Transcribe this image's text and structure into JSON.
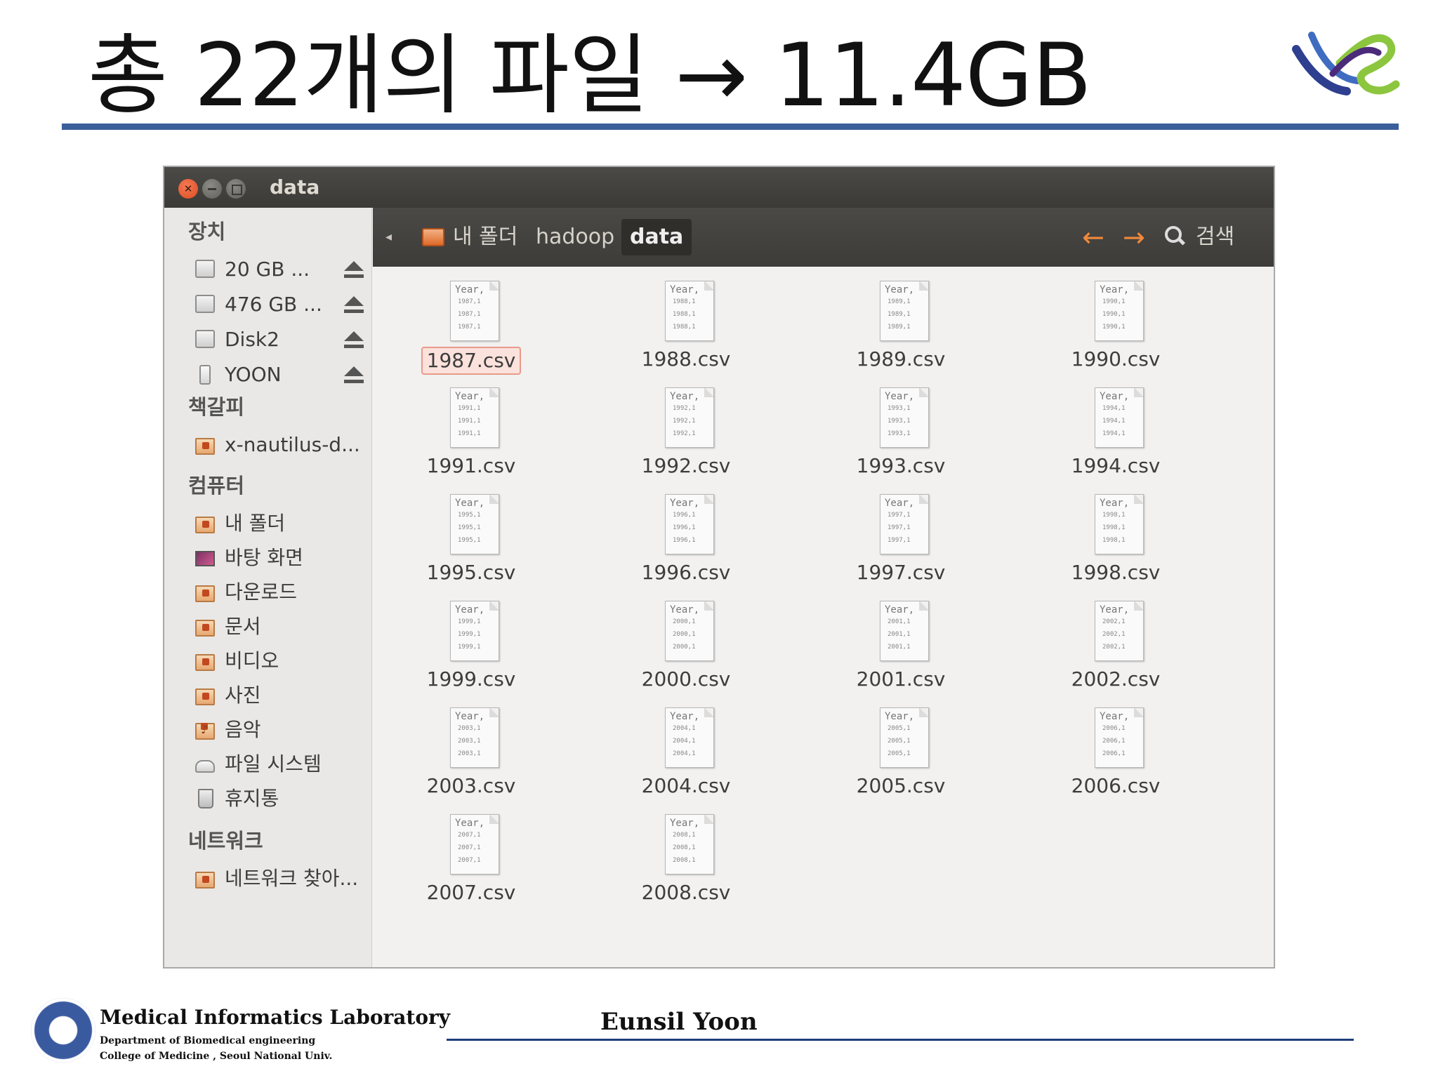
{
  "slide": {
    "title": "총 22개의 파일 → 11.4GB",
    "footer": {
      "lab": "Medical  Informatics Laboratory",
      "department": "Department of Biomedical engineering",
      "college": "College of Medicine , Seoul  National  Univ.",
      "author": "Eunsil Yoon"
    },
    "colors": {
      "title_rule": "#3a5f9a",
      "footer_rule": "#1f3e7a"
    }
  },
  "window": {
    "title": "data",
    "controls": [
      "close-icon",
      "minimize-icon",
      "maximize-icon"
    ],
    "toolbar": {
      "breadcrumbs": [
        "내 폴더",
        "hadoop",
        "data"
      ],
      "active_crumb": "data",
      "back_icon": "←",
      "forward_icon": "→",
      "search_label": "검색"
    },
    "sidebar": {
      "devices_heading": "장치",
      "devices": [
        {
          "label": "20 GB ...",
          "icon": "drive-icon",
          "eject": true
        },
        {
          "label": "476 GB ...",
          "icon": "drive-icon",
          "eject": true
        },
        {
          "label": "Disk2",
          "icon": "drive-icon",
          "eject": true
        },
        {
          "label": "YOON",
          "icon": "usb-icon",
          "eject": true
        }
      ],
      "bookmarks_heading": "책갈피",
      "bookmarks": [
        {
          "label": "x-nautilus-d...",
          "icon": "folder-icon"
        }
      ],
      "computer_heading": "컴퓨터",
      "computer": [
        {
          "label": "내 폴더",
          "icon": "home-folder-icon"
        },
        {
          "label": "바탕 화면",
          "icon": "desktop-icon"
        },
        {
          "label": "다운로드",
          "icon": "downloads-icon"
        },
        {
          "label": "문서",
          "icon": "documents-icon"
        },
        {
          "label": "비디오",
          "icon": "videos-icon"
        },
        {
          "label": "사진",
          "icon": "pictures-icon"
        },
        {
          "label": "음악",
          "icon": "music-icon"
        },
        {
          "label": "파일 시스템",
          "icon": "filesystem-icon"
        },
        {
          "label": "휴지통",
          "icon": "trash-icon"
        }
      ],
      "network_heading": "네트워크",
      "network": [
        {
          "label": "네트워크 찾아...",
          "icon": "network-icon"
        }
      ]
    },
    "files": [
      {
        "name": "1987.csv",
        "preview": [
          "1987,1",
          "1987,1",
          "1987,1"
        ],
        "selected": true
      },
      {
        "name": "1988.csv",
        "preview": [
          "1988,1",
          "1988,1",
          "1988,1"
        ]
      },
      {
        "name": "1989.csv",
        "preview": [
          "1989,1",
          "1989,1",
          "1989,1"
        ]
      },
      {
        "name": "1990.csv",
        "preview": [
          "1990,1",
          "1990,1",
          "1990,1"
        ]
      },
      {
        "name": "1991.csv",
        "preview": [
          "1991,1",
          "1991,1",
          "1991,1"
        ]
      },
      {
        "name": "1992.csv",
        "preview": [
          "1992,1",
          "1992,1",
          "1992,1"
        ]
      },
      {
        "name": "1993.csv",
        "preview": [
          "1993,1",
          "1993,1",
          "1993,1"
        ]
      },
      {
        "name": "1994.csv",
        "preview": [
          "1994,1",
          "1994,1",
          "1994,1"
        ]
      },
      {
        "name": "1995.csv",
        "preview": [
          "1995,1",
          "1995,1",
          "1995,1"
        ]
      },
      {
        "name": "1996.csv",
        "preview": [
          "1996,1",
          "1996,1",
          "1996,1"
        ]
      },
      {
        "name": "1997.csv",
        "preview": [
          "1997,1",
          "1997,1",
          "1997,1"
        ]
      },
      {
        "name": "1998.csv",
        "preview": [
          "1998,1",
          "1998,1",
          "1998,1"
        ]
      },
      {
        "name": "1999.csv",
        "preview": [
          "1999,1",
          "1999,1",
          "1999,1"
        ]
      },
      {
        "name": "2000.csv",
        "preview": [
          "2000,1",
          "2000,1",
          "2000,1"
        ]
      },
      {
        "name": "2001.csv",
        "preview": [
          "2001,1",
          "2001,1",
          "2001,1"
        ]
      },
      {
        "name": "2002.csv",
        "preview": [
          "2002,1",
          "2002,1",
          "2002,1"
        ]
      },
      {
        "name": "2003.csv",
        "preview": [
          "2003,1",
          "2003,1",
          "2003,1"
        ]
      },
      {
        "name": "2004.csv",
        "preview": [
          "2004,1",
          "2004,1",
          "2004,1"
        ]
      },
      {
        "name": "2005.csv",
        "preview": [
          "2005,1",
          "2005,1",
          "2005,1"
        ]
      },
      {
        "name": "2006.csv",
        "preview": [
          "2006,1",
          "2006,1",
          "2006,1"
        ]
      },
      {
        "name": "2007.csv",
        "preview": [
          "2007,1",
          "2007,1",
          "2007,1"
        ]
      },
      {
        "name": "2008.csv",
        "preview": [
          "2008,1",
          "2008,1",
          "2008,1"
        ]
      }
    ],
    "file_preview_header": "Year,"
  }
}
